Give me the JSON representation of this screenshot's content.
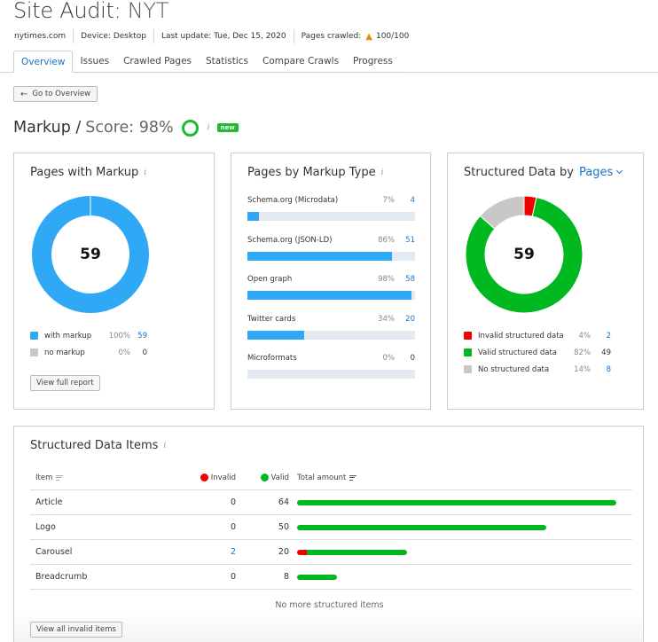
{
  "header": {
    "title_prefix": "Site Audit:",
    "title_project": "NYT",
    "domain": "nytimes.com",
    "device": "Device: Desktop",
    "last_update": "Last update: Tue, Dec 15, 2020",
    "pages_crawled_label": "Pages crawled:",
    "pages_crawled_icon": "warning-icon",
    "pages_crawled_value": "100/100"
  },
  "tabs": [
    {
      "label": "Overview",
      "active": true
    },
    {
      "label": "Issues",
      "active": false
    },
    {
      "label": "Crawled Pages",
      "active": false
    },
    {
      "label": "Statistics",
      "active": false
    },
    {
      "label": "Compare Crawls",
      "active": false
    },
    {
      "label": "Progress",
      "active": false
    }
  ],
  "go_to_overview": "Go to Overview",
  "section": {
    "title": "Markup /",
    "score_label": "Score: 98%",
    "score_value": 98,
    "info": "i",
    "badge": "new"
  },
  "colors": {
    "blue": "#2fa9f5",
    "green": "#00b81f",
    "red": "#f10000",
    "gray": "#c8c8c8",
    "link": "#1a73c8"
  },
  "pages_with_markup": {
    "title": "Pages with Markup",
    "info": "i",
    "center": "59",
    "legend": [
      {
        "label": "with markup",
        "pct": "100%",
        "value": "59",
        "value_num": 59,
        "color": "#2fa9f5",
        "link": true
      },
      {
        "label": "no markup",
        "pct": "0%",
        "value": "0",
        "value_num": 0,
        "color": "#c8c8c8",
        "link": false
      }
    ],
    "button": "View full report"
  },
  "pages_by_markup_type": {
    "title": "Pages by Markup Type",
    "info": "i",
    "rows": [
      {
        "name": "Schema.org (Microdata)",
        "pct": "7%",
        "pct_num": 7,
        "value": "4",
        "link": true
      },
      {
        "name": "Schema.org (JSON-LD)",
        "pct": "86%",
        "pct_num": 86,
        "value": "51",
        "link": true
      },
      {
        "name": "Open graph",
        "pct": "98%",
        "pct_num": 98,
        "value": "58",
        "link": true
      },
      {
        "name": "Twitter cards",
        "pct": "34%",
        "pct_num": 34,
        "value": "20",
        "link": true
      },
      {
        "name": "Microformats",
        "pct": "0%",
        "pct_num": 0,
        "value": "0",
        "link": false
      }
    ]
  },
  "structured_data_by": {
    "title": "Structured Data by",
    "dropdown": "Pages",
    "center": "59",
    "legend": [
      {
        "label": "Invalid structured data",
        "pct": "4%",
        "value": "2",
        "value_num": 2,
        "color": "#f10000",
        "link": true
      },
      {
        "label": "Valid structured data",
        "pct": "82%",
        "value": "49",
        "value_num": 49,
        "color": "#00b81f",
        "link": false
      },
      {
        "label": "No structured data",
        "pct": "14%",
        "value": "8",
        "value_num": 8,
        "color": "#c8c8c8",
        "link": true
      }
    ]
  },
  "structured_data_items": {
    "title": "Structured Data Items",
    "info": "i",
    "columns": {
      "item": "Item",
      "invalid": "Invalid",
      "valid": "Valid",
      "total": "Total amount"
    },
    "rows": [
      {
        "item": "Article",
        "invalid": "0",
        "invalid_num": 0,
        "valid": "64",
        "valid_num": 64,
        "invalid_link": false
      },
      {
        "item": "Logo",
        "invalid": "0",
        "invalid_num": 0,
        "valid": "50",
        "valid_num": 50,
        "invalid_link": false
      },
      {
        "item": "Carousel",
        "invalid": "2",
        "invalid_num": 2,
        "valid": "20",
        "valid_num": 20,
        "invalid_link": true
      },
      {
        "item": "Breadcrumb",
        "invalid": "0",
        "invalid_num": 0,
        "valid": "8",
        "valid_num": 8,
        "invalid_link": false
      }
    ],
    "empty_note": "No more structured items",
    "button": "View all invalid items"
  }
}
